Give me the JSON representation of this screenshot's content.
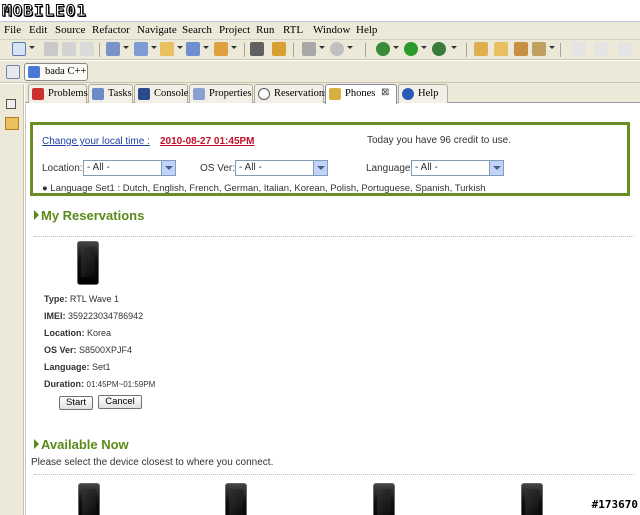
{
  "watermark": {
    "logo": "MOBILE01",
    "id": "#173670"
  },
  "menubar": [
    "File",
    "Edit",
    "Source",
    "Refactor",
    "Navigate",
    "Search",
    "Project",
    "Run",
    "RTL",
    "Window",
    "Help"
  ],
  "perspective": {
    "label": "bada C++"
  },
  "tabs": [
    {
      "label": "Problems",
      "icon": "problems-icon"
    },
    {
      "label": "Tasks",
      "icon": "tasks-icon"
    },
    {
      "label": "Console",
      "icon": "console-icon"
    },
    {
      "label": "Properties",
      "icon": "properties-icon"
    },
    {
      "label": "Reservations",
      "icon": "reservations-icon"
    },
    {
      "label": "Phones",
      "icon": "phones-icon",
      "active": true,
      "close": "⊠"
    },
    {
      "label": "Help",
      "icon": "help-icon"
    }
  ],
  "filter": {
    "change_time_link": "Change your local time :",
    "time_value": "2010-08-27 01:45PM",
    "credit_text": "Today you have 96 credit to use.",
    "location_label": "Location:",
    "location_value": "- All -",
    "osver_label": "OS Ver:",
    "osver_value": "- All -",
    "language_label": "Language:",
    "language_value": "- All -",
    "language_set": "Language Set1 : Dutch, English, French, German, Italian, Korean, Polish, Portuguese, Spanish, Turkish"
  },
  "reservations": {
    "heading": "My Reservations",
    "type_label": "Type:",
    "type_value": "RTL Wave 1",
    "imei_label": "IMEI:",
    "imei_value": "359223034786942",
    "location_label": "Location:",
    "location_value": "Korea",
    "osver_label": "OS Ver:",
    "osver_value": "S8500XPJF4",
    "language_label": "Language:",
    "language_value": "Set1",
    "duration_label": "Duration:",
    "duration_value": "01:45PM~01:59PM",
    "start_button": "Start",
    "cancel_button": "Cancel"
  },
  "available": {
    "heading": "Available Now",
    "hint": "Please select the device closest to where you connect."
  },
  "colors": {
    "accent_green": "#6b8e23",
    "link_blue": "#1f3f9f",
    "time_red": "#c0102a"
  }
}
